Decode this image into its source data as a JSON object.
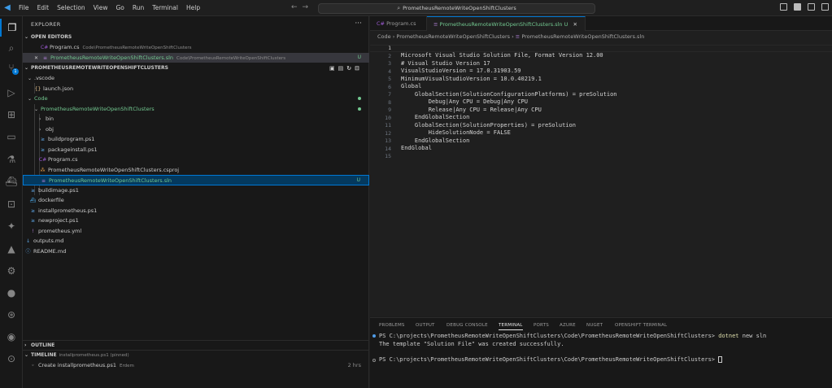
{
  "menu": [
    "File",
    "Edit",
    "Selection",
    "View",
    "Go",
    "Run",
    "Terminal",
    "Help"
  ],
  "command_center": "PrometheusRemoteWriteOpenShiftClusters",
  "explorer": {
    "title": "EXPLORER",
    "open_editors_label": "OPEN EDITORS",
    "open_editors": [
      {
        "name": "Program.cs",
        "desc": "Code\\PrometheusRemoteWriteOpenShiftClusters",
        "status": ""
      },
      {
        "name": "PrometheusRemoteWriteOpenShiftClusters.sln",
        "desc": "Code\\PrometheusRemoteWriteOpenShiftClusters",
        "status": "U"
      }
    ],
    "folder_label": "PROMETHEUSREMOTEWRITEOPENSHIFTCLUSTERS",
    "tree": [
      {
        "name": ".vscode"
      },
      {
        "name": "launch.json"
      },
      {
        "name": "Code"
      },
      {
        "name": "PrometheusRemoteWriteOpenShiftClusters"
      },
      {
        "name": "bin"
      },
      {
        "name": "obj"
      },
      {
        "name": "buildprogram.ps1"
      },
      {
        "name": "packageinstall.ps1"
      },
      {
        "name": "Program.cs"
      },
      {
        "name": "PrometheusRemoteWriteOpenShiftClusters.csproj"
      },
      {
        "name": "PrometheusRemoteWriteOpenShiftClusters.sln",
        "status": "U"
      },
      {
        "name": "buildimage.ps1"
      },
      {
        "name": "dockerfile"
      },
      {
        "name": "installprometheus.ps1"
      },
      {
        "name": "newproject.ps1"
      },
      {
        "name": "prometheus.yml"
      },
      {
        "name": "outputs.md"
      },
      {
        "name": "README.md"
      }
    ],
    "outline_label": "OUTLINE",
    "timeline_label": "TIMELINE",
    "timeline_hint": "installprometheus.ps1 (pinned)",
    "timeline_entry": "Create installprometheus.ps1",
    "timeline_author": "Erdem",
    "timeline_time": "2 hrs"
  },
  "tabs": [
    {
      "name": "Program.cs"
    },
    {
      "name": "PrometheusRemoteWriteOpenShiftClusters.sln",
      "status": "U"
    }
  ],
  "breadcrumb": {
    "part1": "Code",
    "part2": "PrometheusRemoteWriteOpenShiftClusters",
    "part3": "PrometheusRemoteWriteOpenShiftClusters.sln"
  },
  "code_lines": [
    "",
    "Microsoft Visual Studio Solution File, Format Version 12.00",
    "# Visual Studio Version 17",
    "VisualStudioVersion = 17.0.31903.59",
    "MinimumVisualStudioVersion = 10.0.40219.1",
    "Global",
    "    GlobalSection(SolutionConfigurationPlatforms) = preSolution",
    "        Debug|Any CPU = Debug|Any CPU",
    "        Release|Any CPU = Release|Any CPU",
    "    EndGlobalSection",
    "    GlobalSection(SolutionProperties) = preSolution",
    "        HideSolutionNode = FALSE",
    "    EndGlobalSection",
    "EndGlobal",
    ""
  ],
  "line_numbers": [
    "1",
    "2",
    "3",
    "4",
    "5",
    "6",
    "7",
    "8",
    "9",
    "10",
    "11",
    "12",
    "13",
    "14",
    "15"
  ],
  "panel_tabs": [
    "PROBLEMS",
    "OUTPUT",
    "DEBUG CONSOLE",
    "TERMINAL",
    "PORTS",
    "AZURE",
    "NUGET",
    "OPENSHIFT TERMINAL"
  ],
  "terminal": {
    "prompt1": "PS C:\\projects\\PrometheusRemoteWriteOpenShiftClusters\\Code\\PrometheusRemoteWriteOpenShiftClusters>",
    "cmd_name": "dotnet",
    "cmd_args": "new sln",
    "output": "The template \"Solution File\" was created successfully.",
    "prompt2": "PS C:\\projects\\PrometheusRemoteWriteOpenShiftClusters\\Code\\PrometheusRemoteWriteOpenShiftClusters>"
  },
  "scm_badge": "1"
}
